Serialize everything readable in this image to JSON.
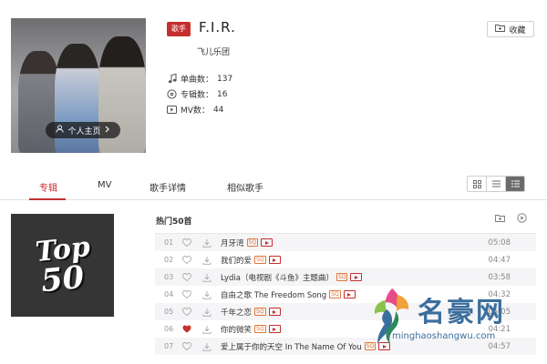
{
  "artist": {
    "badge": "歌手",
    "name": "F.I.R.",
    "alias": "飞儿乐团",
    "home_label": "个人主页",
    "collect_label": "收藏",
    "stats": [
      {
        "icon": "music-note-icon",
        "label": "单曲数：",
        "value": "137"
      },
      {
        "icon": "album-disc-icon",
        "label": "专辑数：",
        "value": "16"
      },
      {
        "icon": "mv-play-icon",
        "label": "MV数：",
        "value": "44"
      }
    ]
  },
  "tabs": [
    {
      "label": "专辑",
      "active": true
    },
    {
      "label": "MV",
      "active": false
    },
    {
      "label": "歌手详情",
      "active": false
    },
    {
      "label": "相似歌手",
      "active": false
    }
  ],
  "album": {
    "art_line1": "Top",
    "art_line2": "50",
    "title": "热门50首"
  },
  "tracks": [
    {
      "num": "01",
      "liked": false,
      "name": "月牙湾",
      "sq": "SQ",
      "duration": "05:08"
    },
    {
      "num": "02",
      "liked": false,
      "name": "我们的爱",
      "sq": "SQ",
      "duration": "04:47"
    },
    {
      "num": "03",
      "liked": false,
      "name": "Lydia（电视剧《斗鱼》主题曲）",
      "sq": "SQ",
      "duration": "03:58"
    },
    {
      "num": "04",
      "liked": false,
      "name": "自由之歌 The Freedom Song",
      "sq": "SQ",
      "duration": "04:32"
    },
    {
      "num": "05",
      "liked": false,
      "name": "千年之恋",
      "sq": "SQ",
      "duration": "05:05"
    },
    {
      "num": "06",
      "liked": true,
      "name": "你的微笑",
      "sq": "SQ",
      "duration": "04:21"
    },
    {
      "num": "07",
      "liked": false,
      "name": "爱上属于你的天空 In The Name Of You",
      "sq": "SQ",
      "duration": "04:57"
    }
  ],
  "watermark": {
    "text": "名豪网",
    "url": "minghaoshangwu.com"
  },
  "colors": {
    "accent": "#c62f2f",
    "sq": "#e07a3a"
  }
}
